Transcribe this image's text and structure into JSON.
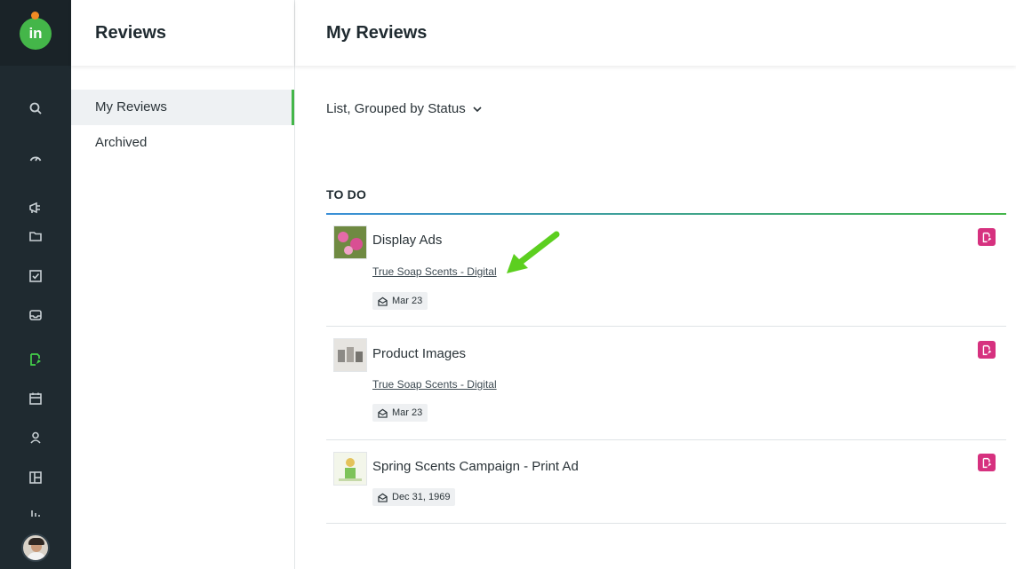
{
  "app": {
    "logo_text": "in"
  },
  "rail": {
    "items": [
      {
        "icon": "search-icon"
      },
      {
        "icon": "dashboard-gauge-icon"
      },
      {
        "icon": "megaphone-icon"
      },
      {
        "icon": "folder-icon"
      },
      {
        "icon": "task-checkbox-icon"
      },
      {
        "icon": "inbox-icon"
      },
      {
        "icon": "review-icon",
        "active": true
      },
      {
        "icon": "calendar-icon"
      },
      {
        "icon": "user-icon"
      },
      {
        "icon": "board-icon"
      },
      {
        "icon": "chart-icon"
      }
    ]
  },
  "subnav": {
    "title": "Reviews",
    "items": [
      {
        "label": "My Reviews",
        "active": true
      },
      {
        "label": "Archived",
        "active": false
      }
    ]
  },
  "main": {
    "title": "My Reviews",
    "view_select": "List, Grouped by Status",
    "section": "TO DO",
    "reviews": [
      {
        "title": "Display Ads",
        "project": "True Soap Scents - Digital",
        "date": "Mar 23",
        "thumb": "flowers-image"
      },
      {
        "title": "Product Images",
        "project": "True Soap Scents - Digital",
        "date": "Mar 23",
        "thumb": "product-image"
      },
      {
        "title": "Spring Scents Campaign - Print Ad",
        "project": "",
        "date": "Dec 31, 1969",
        "thumb": "print-ad-image"
      }
    ]
  },
  "colors": {
    "accent": "#44b649",
    "action": "#d6317f",
    "rail": "#1f2a30",
    "annotation_arrow": "#5ccf1f"
  }
}
